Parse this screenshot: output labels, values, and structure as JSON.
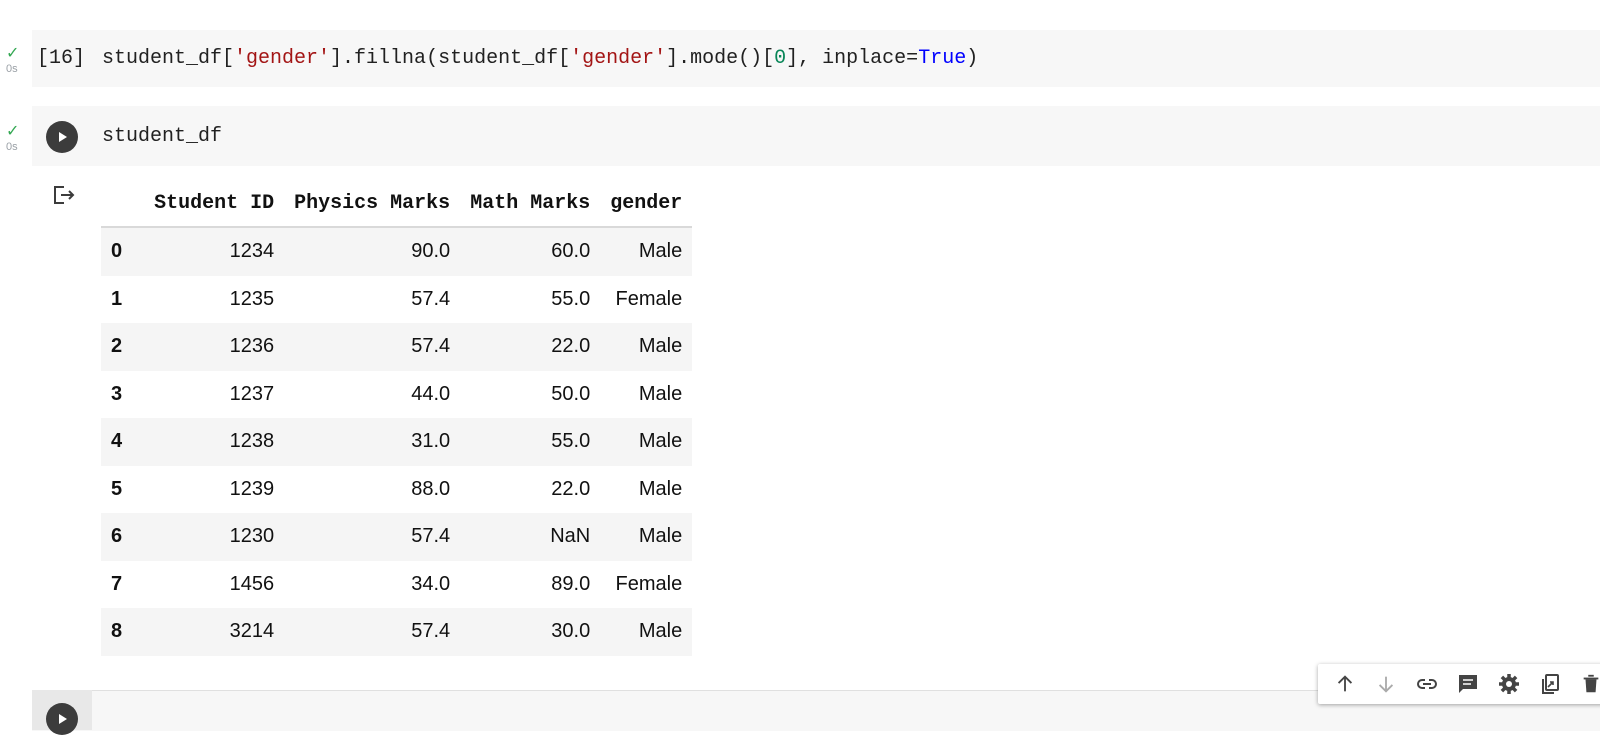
{
  "cells": [
    {
      "status": "✓",
      "time": "0s",
      "exec_count": "[16]",
      "code": {
        "p1": "student_df[",
        "s1": "'gender'",
        "p2": "].fillna(student_df[",
        "s2": "'gender'",
        "p3": "].mode()[",
        "n1": "0",
        "p4": "], inplace=",
        "k1": "True",
        "p5": ")"
      }
    },
    {
      "status": "✓",
      "time": "0s",
      "code": "student_df"
    }
  ],
  "table": {
    "columns": [
      "",
      "Student ID",
      "Physics Marks",
      "Math Marks",
      "gender"
    ],
    "rows": [
      [
        "0",
        "1234",
        "90.0",
        "60.0",
        "Male"
      ],
      [
        "1",
        "1235",
        "57.4",
        "55.0",
        "Female"
      ],
      [
        "2",
        "1236",
        "57.4",
        "22.0",
        "Male"
      ],
      [
        "3",
        "1237",
        "44.0",
        "50.0",
        "Male"
      ],
      [
        "4",
        "1238",
        "31.0",
        "55.0",
        "Male"
      ],
      [
        "5",
        "1239",
        "88.0",
        "22.0",
        "Male"
      ],
      [
        "6",
        "1230",
        "57.4",
        "NaN",
        "Male"
      ],
      [
        "7",
        "1456",
        "34.0",
        "89.0",
        "Female"
      ],
      [
        "8",
        "3214",
        "57.4",
        "30.0",
        "Male"
      ]
    ]
  },
  "toolbar": {
    "icons": [
      "move-up-icon",
      "move-down-icon",
      "link-icon",
      "comment-icon",
      "settings-icon",
      "mirror-cell-icon",
      "delete-icon"
    ]
  },
  "colors": {
    "string": "#a31515",
    "number": "#098658",
    "keyword": "#0000ff",
    "check": "#34a853"
  }
}
